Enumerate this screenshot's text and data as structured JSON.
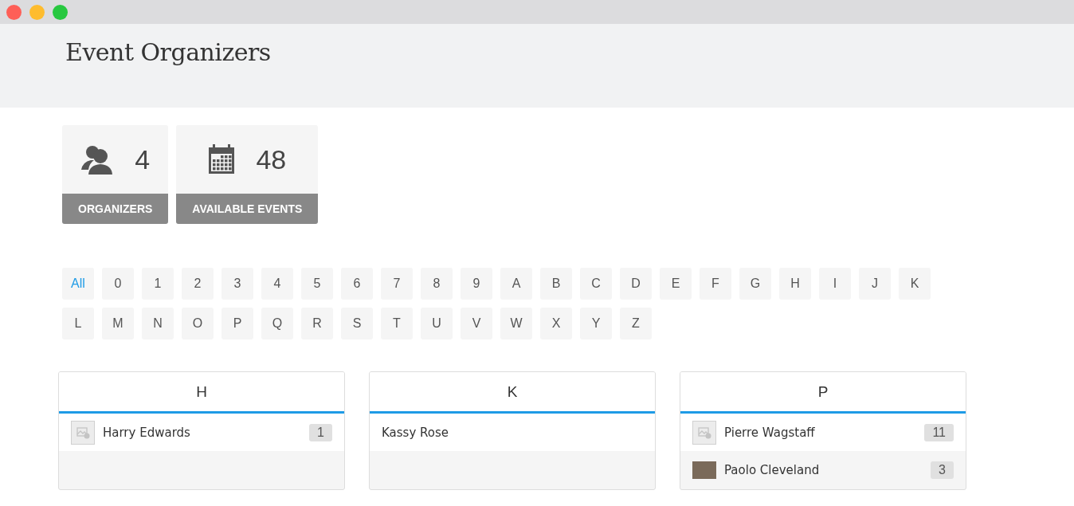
{
  "page": {
    "title": "Event Organizers"
  },
  "stats": [
    {
      "kind": "people",
      "value": "4",
      "label": "ORGANIZERS"
    },
    {
      "kind": "calendar",
      "value": "48",
      "label": "AVAILABLE EVENTS"
    }
  ],
  "letters": [
    {
      "label": "All",
      "selected": true
    },
    {
      "label": "0",
      "selected": false
    },
    {
      "label": "1",
      "selected": false
    },
    {
      "label": "2",
      "selected": false
    },
    {
      "label": "3",
      "selected": false
    },
    {
      "label": "4",
      "selected": false
    },
    {
      "label": "5",
      "selected": false
    },
    {
      "label": "6",
      "selected": false
    },
    {
      "label": "7",
      "selected": false
    },
    {
      "label": "8",
      "selected": false
    },
    {
      "label": "9",
      "selected": false
    },
    {
      "label": "A",
      "selected": false
    },
    {
      "label": "B",
      "selected": false
    },
    {
      "label": "C",
      "selected": false
    },
    {
      "label": "D",
      "selected": false
    },
    {
      "label": "E",
      "selected": false
    },
    {
      "label": "F",
      "selected": false
    },
    {
      "label": "G",
      "selected": false
    },
    {
      "label": "H",
      "selected": false
    },
    {
      "label": "I",
      "selected": false
    },
    {
      "label": "J",
      "selected": false
    },
    {
      "label": "K",
      "selected": false
    },
    {
      "label": "L",
      "selected": false
    },
    {
      "label": "M",
      "selected": false
    },
    {
      "label": "N",
      "selected": false
    },
    {
      "label": "O",
      "selected": false
    },
    {
      "label": "P",
      "selected": false
    },
    {
      "label": "Q",
      "selected": false
    },
    {
      "label": "R",
      "selected": false
    },
    {
      "label": "S",
      "selected": false
    },
    {
      "label": "T",
      "selected": false
    },
    {
      "label": "U",
      "selected": false
    },
    {
      "label": "V",
      "selected": false
    },
    {
      "label": "W",
      "selected": false
    },
    {
      "label": "X",
      "selected": false
    },
    {
      "label": "Y",
      "selected": false
    },
    {
      "label": "Z",
      "selected": false
    }
  ],
  "groups": [
    {
      "letter": "H",
      "organizers": [
        {
          "name": "Harry Edwards",
          "kind": "placeholder",
          "count": "1"
        }
      ]
    },
    {
      "letter": "K",
      "organizers": [
        {
          "name": "Kassy Rose",
          "kind": "plain"
        }
      ]
    },
    {
      "letter": "P",
      "organizers": [
        {
          "name": "Pierre Wagstaff",
          "kind": "placeholder",
          "count": "11"
        },
        {
          "name": "Paolo Cleveland",
          "kind": "photo",
          "count": "3"
        }
      ]
    }
  ]
}
